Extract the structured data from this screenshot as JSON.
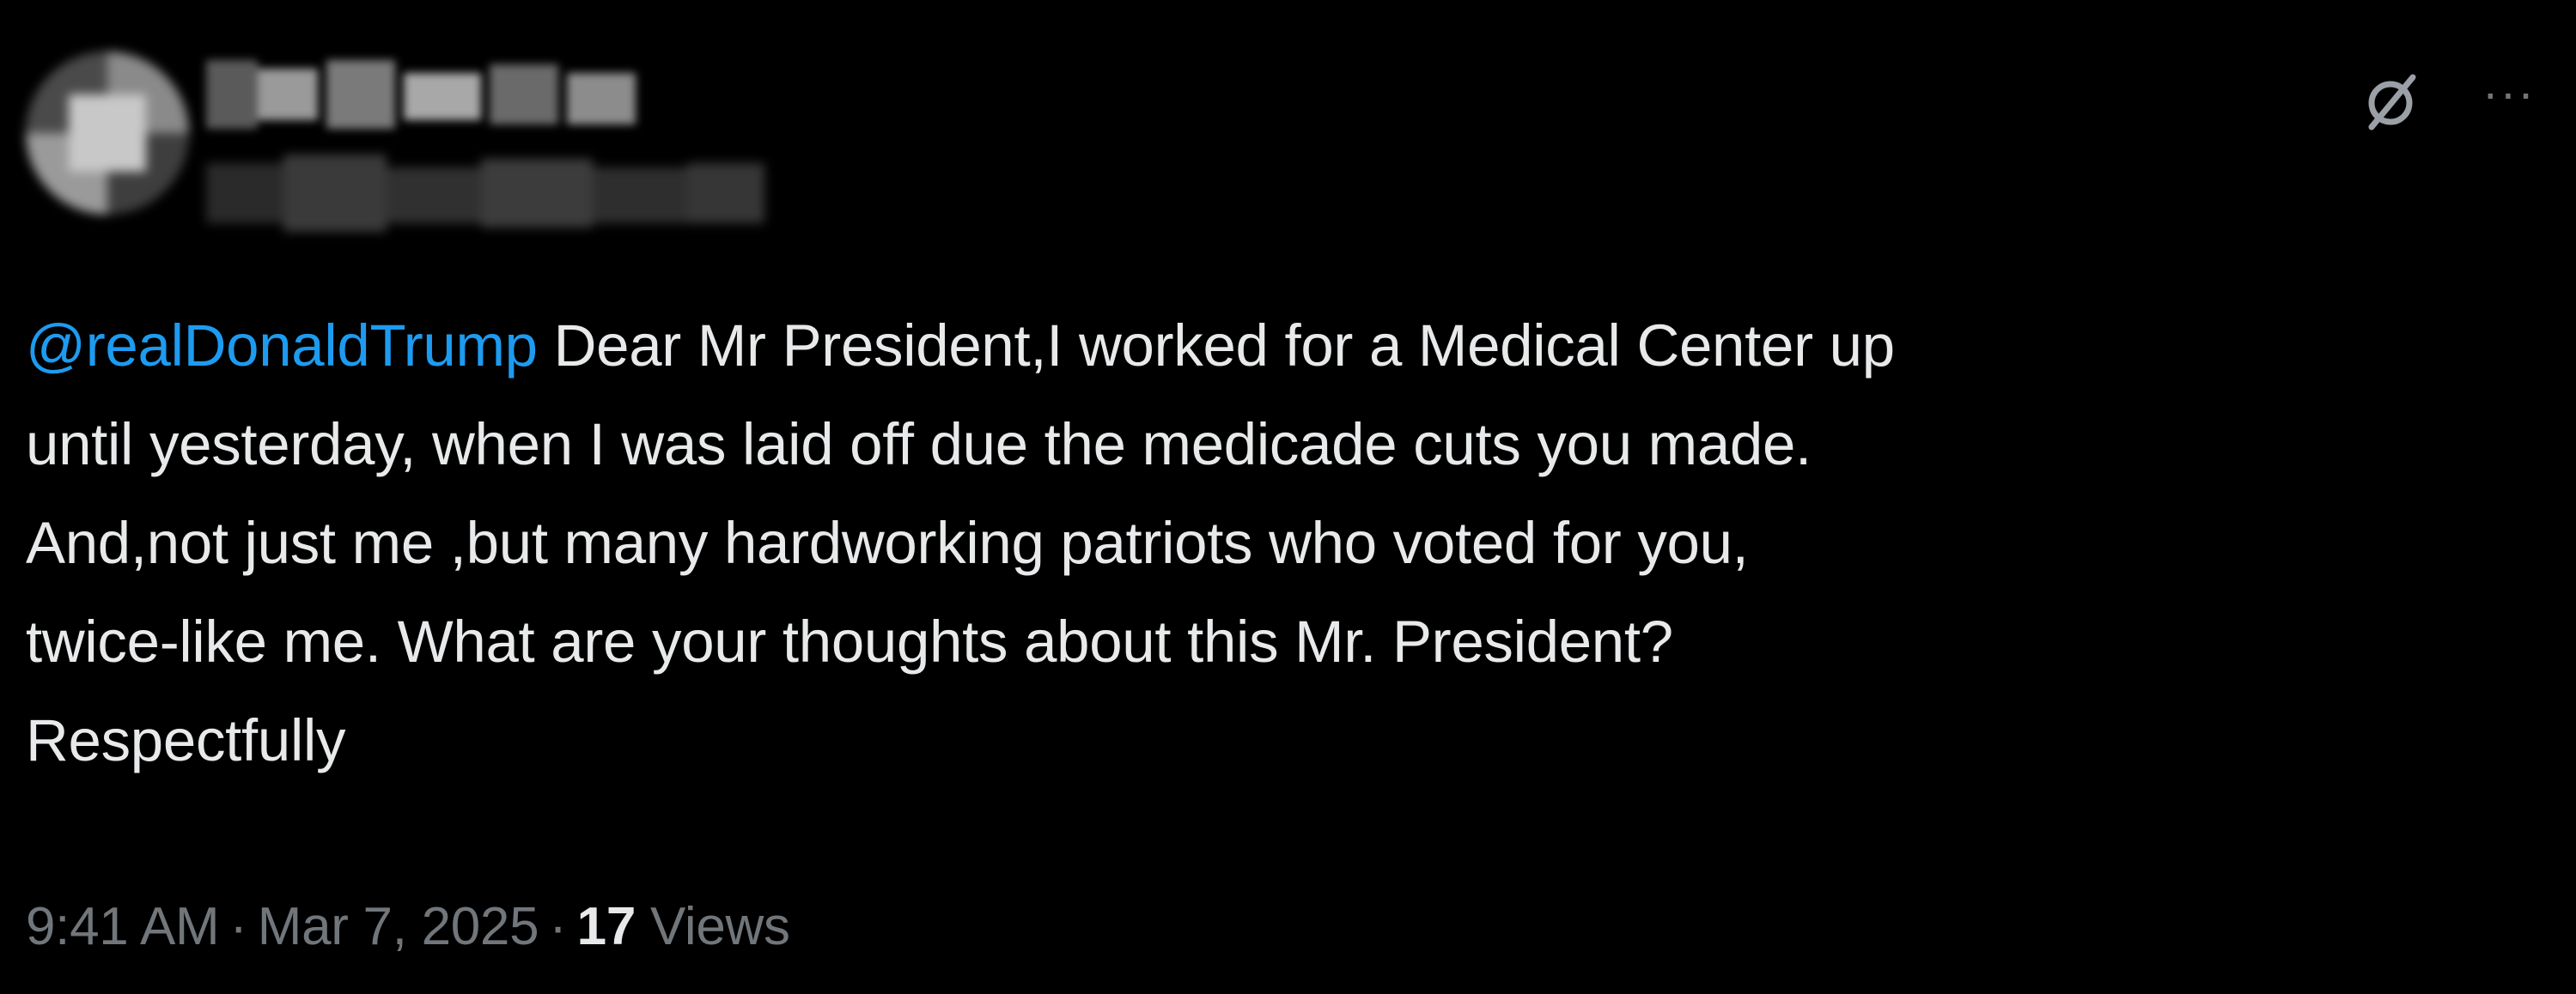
{
  "tweet": {
    "mention": "@realDonaldTrump",
    "text_lines": [
      " Dear Mr President,I worked for a Medical Center up",
      "until yesterday, when I was laid off due the medicade cuts you made.",
      "And,not just me ,but many hardworking patriots who voted for you,",
      "twice-like me. What are your thoughts about this Mr. President?",
      "Respectfully"
    ],
    "time": "9:41 AM",
    "separator": "·",
    "date": "Mar 7, 2025",
    "views_count": "17",
    "views_label": "Views"
  },
  "icons": {
    "grok": "grok-icon",
    "more": "more-icon",
    "more_glyph": "···"
  },
  "colors": {
    "background": "#000000",
    "text": "#e7e9ea",
    "mention": "#1d9bf0",
    "muted": "#71767b"
  }
}
